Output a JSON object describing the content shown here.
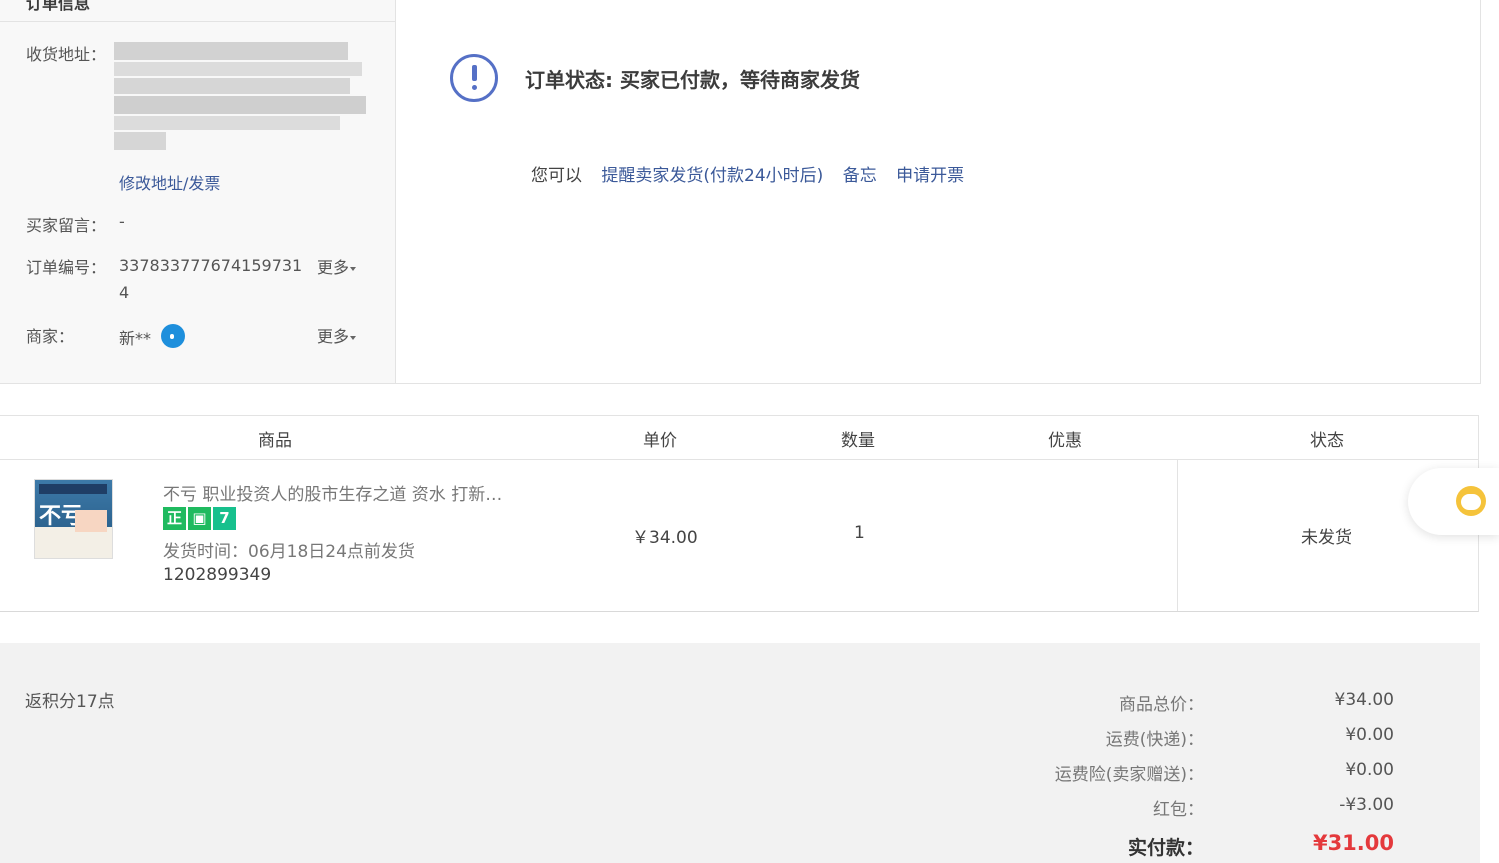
{
  "info": {
    "title": "订单信息",
    "address_label": "收货地址：",
    "edit_link": "修改地址/发票",
    "buyer_msg_label": "买家留言：",
    "buyer_msg_value": "-",
    "order_no_label": "订单编号：",
    "order_no_line1": "337833777674159731",
    "order_no_line2": "4",
    "more_label": "更多",
    "merchant_label": "商家：",
    "merchant_value": "新**"
  },
  "status": {
    "text": "订单状态: 买家已付款，等待商家发货",
    "actions_prefix": "您可以",
    "actions": [
      "提醒卖家发货(付款24小时后)",
      "备忘",
      "申请开票"
    ]
  },
  "table": {
    "headers": [
      "商品",
      "单价",
      "数量",
      "优惠",
      "状态"
    ],
    "row": {
      "name": "不亏 职业投资人的股市生存之道 资水 打新…",
      "badges": [
        "正",
        "",
        "7"
      ],
      "ship_time": "发货时间：06月18日24点前发货",
      "id": "1202899349",
      "price": "￥34.00",
      "qty": "1",
      "discount": "",
      "status": "未发货",
      "cover_char": "不亏"
    }
  },
  "summary": {
    "points": "返积分17点",
    "rows": [
      {
        "label": "商品总价：",
        "value": "¥34.00"
      },
      {
        "label": "运费(快递)：",
        "value": "¥0.00"
      },
      {
        "label": "运费险(卖家赠送)：",
        "value": "¥0.00"
      },
      {
        "label": "红包：",
        "value": "-¥3.00"
      }
    ],
    "total_label": "实付款：",
    "total_value": "¥31.00"
  },
  "colors": {
    "link": "#3b5999",
    "accent_red": "#e4393c",
    "status_icon": "#5570c6",
    "badge_green": "#1fba5f",
    "badge_teal": "#17c08d"
  }
}
